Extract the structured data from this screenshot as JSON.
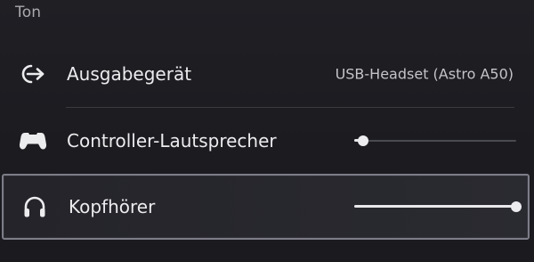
{
  "section": {
    "title": "Ton"
  },
  "rows": [
    {
      "label": "Ausgabegerät",
      "value": "USB-Headset (Astro A50)",
      "icon": "output-device-icon"
    },
    {
      "label": "Controller-Lautsprecher",
      "icon": "gamepad-icon",
      "volume": 0.02
    },
    {
      "label": "Kopfhörer",
      "icon": "headphones-icon",
      "volume": 1.0,
      "selected": true
    }
  ],
  "colors": {
    "background": "#1d1d22",
    "selection_border": "#7d7d88",
    "slider_fill": "#e8e8ea",
    "slider_track": "#4a4a52"
  }
}
